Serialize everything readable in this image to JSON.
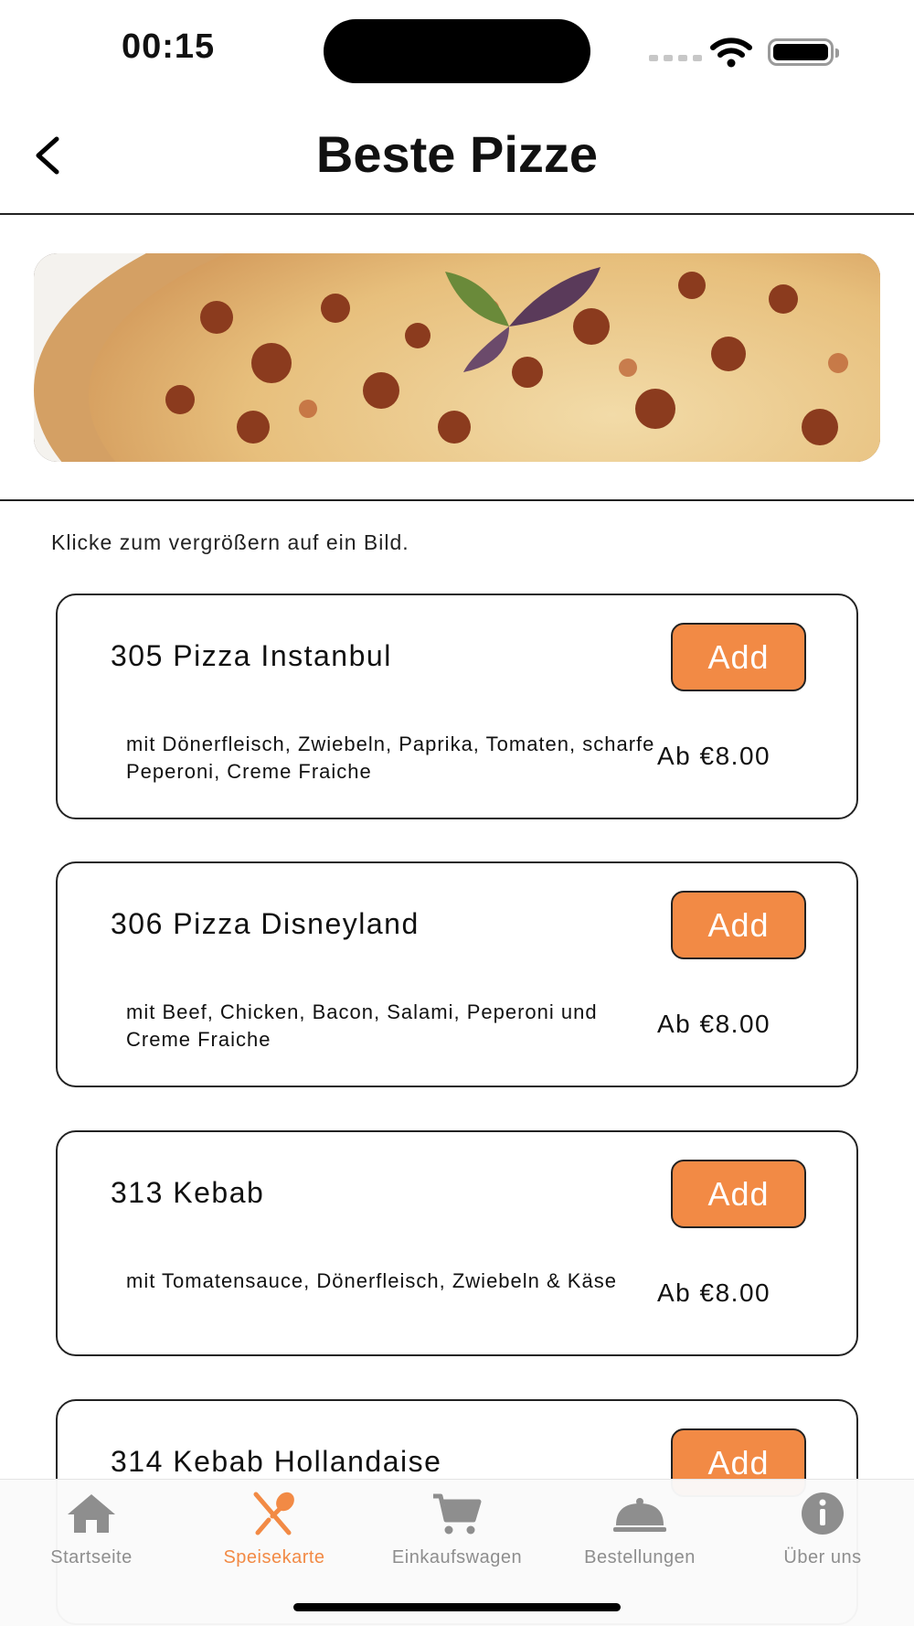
{
  "status": {
    "time": "00:15"
  },
  "nav": {
    "title": "Beste Pizze"
  },
  "hint": "Klicke zum vergrößern auf ein Bild.",
  "menu": [
    {
      "title": "305 Pizza Instanbul",
      "description": "mit Dönerfleisch, Zwiebeln, Paprika, Tomaten, scharfe Peperoni, Creme Fraiche",
      "price": "Ab €8.00",
      "add_label": "Add"
    },
    {
      "title": "306 Pizza Disneyland",
      "description": "mit Beef, Chicken, Bacon, Salami, Peperoni und Creme Fraiche",
      "price": "Ab €8.00",
      "add_label": "Add"
    },
    {
      "title": "313  Kebab",
      "description": "mit Tomatensauce, Dönerfleisch, Zwiebeln & Käse",
      "price": "Ab €8.00",
      "add_label": "Add"
    },
    {
      "title": "314 Kebab Hollandaise",
      "add_label": "Add"
    }
  ],
  "tabs": [
    {
      "label": "Startseite",
      "icon": "home-icon"
    },
    {
      "label": "Speisekarte",
      "icon": "fork-spoon-icon",
      "active": true
    },
    {
      "label": "Einkaufswagen",
      "icon": "cart-icon"
    },
    {
      "label": "Bestellungen",
      "icon": "cloche-icon"
    },
    {
      "label": "Über uns",
      "icon": "info-icon"
    }
  ],
  "colors": {
    "accent": "#f28a45",
    "tab_inactive": "#8e8e8e",
    "border": "#222222"
  }
}
